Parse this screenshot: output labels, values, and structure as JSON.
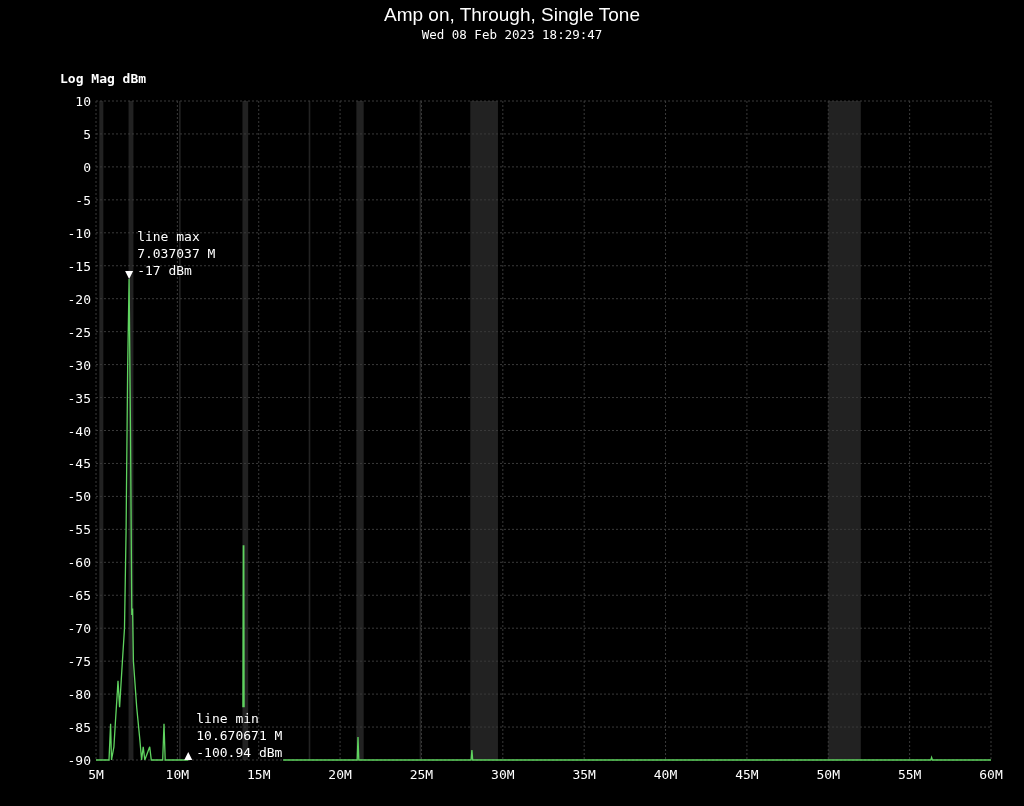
{
  "title": "Amp on, Through, Single Tone",
  "subtitle": "Wed 08 Feb 2023 18:29:47",
  "chart_data": {
    "type": "line",
    "ylabel": "Log Mag dBm",
    "grid": true,
    "xlim": [
      5,
      60
    ],
    "ylim": [
      -90,
      10
    ],
    "xticks": [
      {
        "value": 5,
        "label": "5M"
      },
      {
        "value": 10,
        "label": "10M"
      },
      {
        "value": 15,
        "label": "15M"
      },
      {
        "value": 20,
        "label": "20M"
      },
      {
        "value": 25,
        "label": "25M"
      },
      {
        "value": 30,
        "label": "30M"
      },
      {
        "value": 35,
        "label": "35M"
      },
      {
        "value": 40,
        "label": "40M"
      },
      {
        "value": 45,
        "label": "45M"
      },
      {
        "value": 50,
        "label": "50M"
      },
      {
        "value": 55,
        "label": "55M"
      },
      {
        "value": 60,
        "label": "60M"
      }
    ],
    "yticks": [
      10,
      5,
      0,
      -5,
      -10,
      -15,
      -20,
      -25,
      -30,
      -35,
      -40,
      -45,
      -50,
      -55,
      -60,
      -65,
      -70,
      -75,
      -80,
      -85,
      -90
    ],
    "x": [
      5,
      5.8,
      5.9,
      5.95,
      6.1,
      6.2,
      6.3,
      6.35,
      6.45,
      6.6,
      6.75,
      6.85,
      6.95,
      7.037,
      7.12,
      7.2,
      7.25,
      7.3,
      7.5,
      7.7,
      7.8,
      7.9,
      8.0,
      8.3,
      8.4,
      9.1,
      9.18,
      9.25,
      10.670671,
      12.0,
      14.03,
      14.05,
      14.08,
      14.1,
      15.0,
      16.5,
      21.05,
      21.1,
      21.15,
      28.05,
      28.1,
      28.15,
      56.3,
      56.35,
      56.4,
      60
    ],
    "series": [
      {
        "color": "#5fd35f",
        "values": [
          -90,
          -90,
          -84.5,
          -90,
          -88,
          -84,
          -80,
          -78,
          -82,
          -76,
          -70,
          -55,
          -30,
          -17,
          -40,
          -68,
          -67,
          -75,
          -82,
          -87,
          -90,
          -88,
          -90,
          -88,
          -90,
          -90,
          -84.5,
          -90,
          -90,
          null,
          -82,
          -57.5,
          -57.5,
          -82,
          null,
          -90,
          -90,
          -86.5,
          -90,
          -90,
          -88.5,
          -90,
          -90,
          -89.6,
          -90,
          -90
        ]
      }
    ],
    "bands": [
      {
        "axis": "x",
        "from": 5.2,
        "to": 5.45
      },
      {
        "axis": "x",
        "from": 7.0,
        "to": 7.3
      },
      {
        "axis": "x",
        "from": 10.1,
        "to": 10.2
      },
      {
        "axis": "x",
        "from": 14.0,
        "to": 14.35
      },
      {
        "axis": "x",
        "from": 18.07,
        "to": 18.17
      },
      {
        "axis": "x",
        "from": 21.0,
        "to": 21.45
      },
      {
        "axis": "x",
        "from": 24.89,
        "to": 24.99
      },
      {
        "axis": "x",
        "from": 28.0,
        "to": 29.7
      },
      {
        "axis": "x",
        "from": 50.0,
        "to": 52.0
      }
    ],
    "annotations": [
      {
        "text": "line max\n7.037037 M\n-17 dBm",
        "x": 7.037037,
        "y": -17
      },
      {
        "text": "line min\n10.670671 M\n-100.94 dBm",
        "x": 10.670671,
        "y": -90
      }
    ]
  }
}
